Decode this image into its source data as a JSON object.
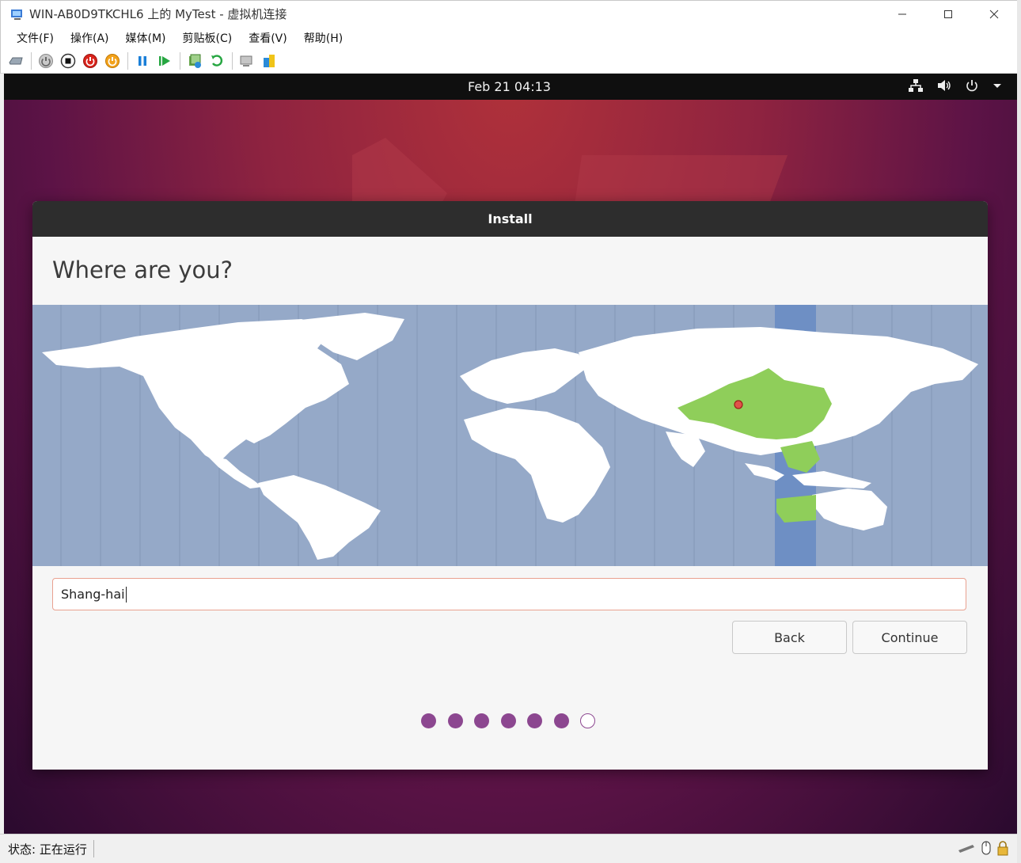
{
  "window": {
    "title": "WIN-AB0D9TKCHL6 上的 MyTest - 虚拟机连接",
    "controls": [
      "minimize-icon",
      "maximize-icon",
      "close-icon"
    ]
  },
  "menu": [
    "文件(F)",
    "操作(A)",
    "媒体(M)",
    "剪贴板(C)",
    "查看(V)",
    "帮助(H)"
  ],
  "toolbar": {
    "icons": [
      "ctrl-alt-del-icon",
      "start-icon",
      "turn-off-icon",
      "shutdown-icon",
      "power-button-icon",
      "pause-icon",
      "resume-icon",
      "checkpoint-icon",
      "revert-icon",
      "enhanced-session-icon",
      "share-icon"
    ]
  },
  "guest": {
    "clock": "Feb 21  04:13",
    "tray_icons": [
      "network-icon",
      "volume-icon",
      "power-icon",
      "chevron-down-icon"
    ]
  },
  "dialog": {
    "title": "Install",
    "heading": "Where are you?",
    "timezone_value": "Shang-hai",
    "buttons": {
      "back": "Back",
      "continue": "Continue"
    },
    "progress": {
      "total": 7,
      "completed": 6
    },
    "selected_region_color": "#8fce5a",
    "ocean_color": "#95a9c8"
  },
  "status": {
    "label": "状态: 正在运行"
  },
  "colors": {
    "accent": "#8c4790",
    "input_focus_border": "#e9a190",
    "topbar": "#0f0f0f"
  }
}
